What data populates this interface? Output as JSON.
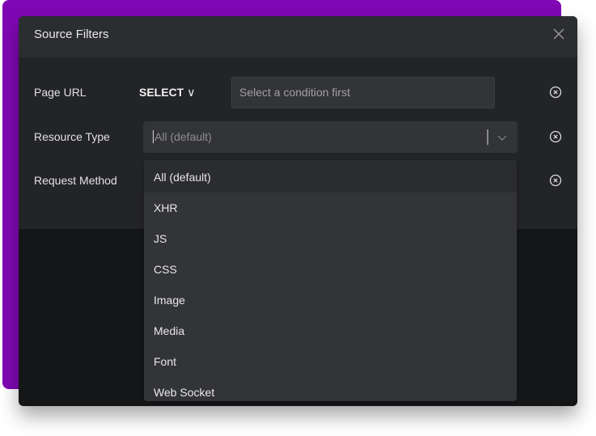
{
  "dialog": {
    "title": "Source Filters"
  },
  "rows": {
    "page_url": {
      "label": "Page URL",
      "condition": "SELECT",
      "placeholder": "Select a condition first"
    },
    "resource_type": {
      "label": "Resource Type",
      "value": "All (default)"
    },
    "request_method": {
      "label": "Request Method"
    }
  },
  "menu": {
    "options": [
      "All (default)",
      "XHR",
      "JS",
      "CSS",
      "Image",
      "Media",
      "Font",
      "Web Socket"
    ]
  },
  "colors": {
    "accent_background": "#8008b4",
    "dialog": "#232427",
    "header": "#2c2d31",
    "menu": "#333438"
  }
}
